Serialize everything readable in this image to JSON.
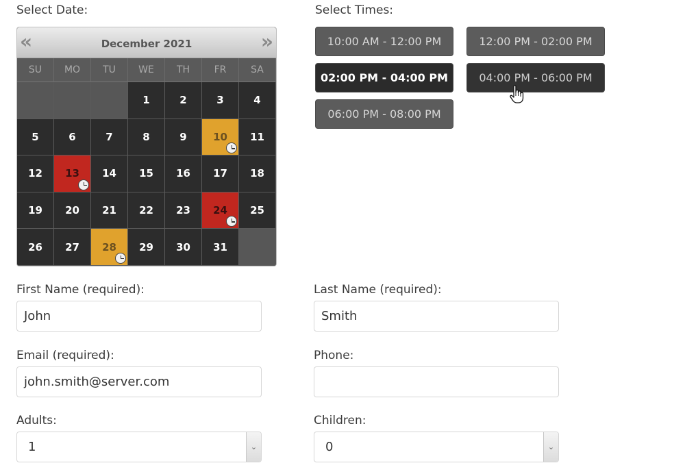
{
  "labels": {
    "select_date": "Select Date:",
    "select_times": "Select Times:",
    "first_name": "First Name (required):",
    "last_name": "Last Name (required):",
    "email": "Email (required):",
    "phone": "Phone:",
    "adults": "Adults:",
    "children": "Children:"
  },
  "calendar": {
    "title": "December 2021",
    "prev": "«",
    "next": "»",
    "weekdays": [
      "SU",
      "MO",
      "TU",
      "WE",
      "TH",
      "FR",
      "SA"
    ],
    "days": [
      "",
      "",
      "",
      "1",
      "2",
      "3",
      "4",
      "5",
      "6",
      "7",
      "8",
      "9",
      "10",
      "11",
      "12",
      "13",
      "14",
      "15",
      "16",
      "17",
      "18",
      "19",
      "20",
      "21",
      "22",
      "23",
      "24",
      "25",
      "26",
      "27",
      "28",
      "29",
      "30",
      "31",
      ""
    ],
    "partially_booked": [
      "10",
      "28"
    ],
    "fully_booked": [
      "13",
      "24"
    ],
    "colors": {
      "partial": "#e0a22d",
      "full": "#c1271f",
      "day": "#2c2c2c"
    }
  },
  "times": {
    "slots": [
      {
        "label": "10:00 AM - 12:00 PM",
        "state": "available"
      },
      {
        "label": "12:00 PM - 02:00 PM",
        "state": "available"
      },
      {
        "label": "02:00 PM - 04:00 PM",
        "state": "selected"
      },
      {
        "label": "04:00 PM - 06:00 PM",
        "state": "hover"
      },
      {
        "label": "06:00 PM - 08:00 PM",
        "state": "available"
      }
    ]
  },
  "form": {
    "first_name": "John",
    "last_name": "Smith",
    "email": "john.smith@server.com",
    "phone": "",
    "adults": "1",
    "children": "0"
  }
}
